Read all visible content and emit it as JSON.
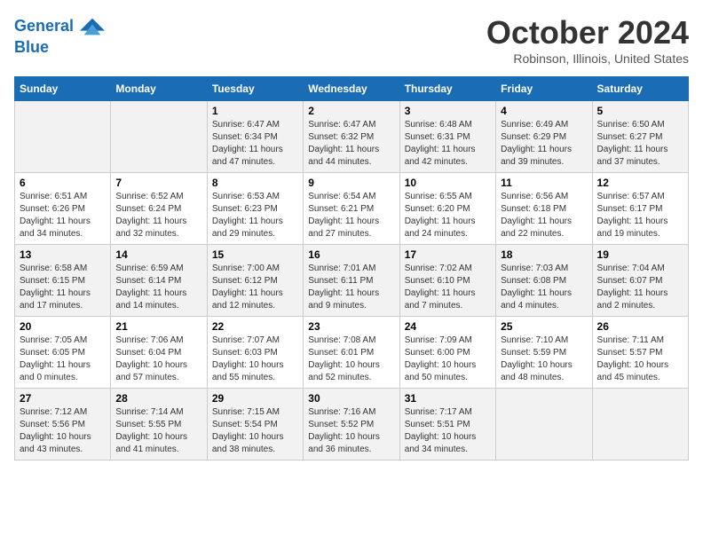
{
  "header": {
    "logo_line1": "General",
    "logo_line2": "Blue",
    "month": "October 2024",
    "location": "Robinson, Illinois, United States"
  },
  "weekdays": [
    "Sunday",
    "Monday",
    "Tuesday",
    "Wednesday",
    "Thursday",
    "Friday",
    "Saturday"
  ],
  "weeks": [
    [
      {
        "day": "",
        "sunrise": "",
        "sunset": "",
        "daylight": ""
      },
      {
        "day": "",
        "sunrise": "",
        "sunset": "",
        "daylight": ""
      },
      {
        "day": "1",
        "sunrise": "Sunrise: 6:47 AM",
        "sunset": "Sunset: 6:34 PM",
        "daylight": "Daylight: 11 hours and 47 minutes."
      },
      {
        "day": "2",
        "sunrise": "Sunrise: 6:47 AM",
        "sunset": "Sunset: 6:32 PM",
        "daylight": "Daylight: 11 hours and 44 minutes."
      },
      {
        "day": "3",
        "sunrise": "Sunrise: 6:48 AM",
        "sunset": "Sunset: 6:31 PM",
        "daylight": "Daylight: 11 hours and 42 minutes."
      },
      {
        "day": "4",
        "sunrise": "Sunrise: 6:49 AM",
        "sunset": "Sunset: 6:29 PM",
        "daylight": "Daylight: 11 hours and 39 minutes."
      },
      {
        "day": "5",
        "sunrise": "Sunrise: 6:50 AM",
        "sunset": "Sunset: 6:27 PM",
        "daylight": "Daylight: 11 hours and 37 minutes."
      }
    ],
    [
      {
        "day": "6",
        "sunrise": "Sunrise: 6:51 AM",
        "sunset": "Sunset: 6:26 PM",
        "daylight": "Daylight: 11 hours and 34 minutes."
      },
      {
        "day": "7",
        "sunrise": "Sunrise: 6:52 AM",
        "sunset": "Sunset: 6:24 PM",
        "daylight": "Daylight: 11 hours and 32 minutes."
      },
      {
        "day": "8",
        "sunrise": "Sunrise: 6:53 AM",
        "sunset": "Sunset: 6:23 PM",
        "daylight": "Daylight: 11 hours and 29 minutes."
      },
      {
        "day": "9",
        "sunrise": "Sunrise: 6:54 AM",
        "sunset": "Sunset: 6:21 PM",
        "daylight": "Daylight: 11 hours and 27 minutes."
      },
      {
        "day": "10",
        "sunrise": "Sunrise: 6:55 AM",
        "sunset": "Sunset: 6:20 PM",
        "daylight": "Daylight: 11 hours and 24 minutes."
      },
      {
        "day": "11",
        "sunrise": "Sunrise: 6:56 AM",
        "sunset": "Sunset: 6:18 PM",
        "daylight": "Daylight: 11 hours and 22 minutes."
      },
      {
        "day": "12",
        "sunrise": "Sunrise: 6:57 AM",
        "sunset": "Sunset: 6:17 PM",
        "daylight": "Daylight: 11 hours and 19 minutes."
      }
    ],
    [
      {
        "day": "13",
        "sunrise": "Sunrise: 6:58 AM",
        "sunset": "Sunset: 6:15 PM",
        "daylight": "Daylight: 11 hours and 17 minutes."
      },
      {
        "day": "14",
        "sunrise": "Sunrise: 6:59 AM",
        "sunset": "Sunset: 6:14 PM",
        "daylight": "Daylight: 11 hours and 14 minutes."
      },
      {
        "day": "15",
        "sunrise": "Sunrise: 7:00 AM",
        "sunset": "Sunset: 6:12 PM",
        "daylight": "Daylight: 11 hours and 12 minutes."
      },
      {
        "day": "16",
        "sunrise": "Sunrise: 7:01 AM",
        "sunset": "Sunset: 6:11 PM",
        "daylight": "Daylight: 11 hours and 9 minutes."
      },
      {
        "day": "17",
        "sunrise": "Sunrise: 7:02 AM",
        "sunset": "Sunset: 6:10 PM",
        "daylight": "Daylight: 11 hours and 7 minutes."
      },
      {
        "day": "18",
        "sunrise": "Sunrise: 7:03 AM",
        "sunset": "Sunset: 6:08 PM",
        "daylight": "Daylight: 11 hours and 4 minutes."
      },
      {
        "day": "19",
        "sunrise": "Sunrise: 7:04 AM",
        "sunset": "Sunset: 6:07 PM",
        "daylight": "Daylight: 11 hours and 2 minutes."
      }
    ],
    [
      {
        "day": "20",
        "sunrise": "Sunrise: 7:05 AM",
        "sunset": "Sunset: 6:05 PM",
        "daylight": "Daylight: 11 hours and 0 minutes."
      },
      {
        "day": "21",
        "sunrise": "Sunrise: 7:06 AM",
        "sunset": "Sunset: 6:04 PM",
        "daylight": "Daylight: 10 hours and 57 minutes."
      },
      {
        "day": "22",
        "sunrise": "Sunrise: 7:07 AM",
        "sunset": "Sunset: 6:03 PM",
        "daylight": "Daylight: 10 hours and 55 minutes."
      },
      {
        "day": "23",
        "sunrise": "Sunrise: 7:08 AM",
        "sunset": "Sunset: 6:01 PM",
        "daylight": "Daylight: 10 hours and 52 minutes."
      },
      {
        "day": "24",
        "sunrise": "Sunrise: 7:09 AM",
        "sunset": "Sunset: 6:00 PM",
        "daylight": "Daylight: 10 hours and 50 minutes."
      },
      {
        "day": "25",
        "sunrise": "Sunrise: 7:10 AM",
        "sunset": "Sunset: 5:59 PM",
        "daylight": "Daylight: 10 hours and 48 minutes."
      },
      {
        "day": "26",
        "sunrise": "Sunrise: 7:11 AM",
        "sunset": "Sunset: 5:57 PM",
        "daylight": "Daylight: 10 hours and 45 minutes."
      }
    ],
    [
      {
        "day": "27",
        "sunrise": "Sunrise: 7:12 AM",
        "sunset": "Sunset: 5:56 PM",
        "daylight": "Daylight: 10 hours and 43 minutes."
      },
      {
        "day": "28",
        "sunrise": "Sunrise: 7:14 AM",
        "sunset": "Sunset: 5:55 PM",
        "daylight": "Daylight: 10 hours and 41 minutes."
      },
      {
        "day": "29",
        "sunrise": "Sunrise: 7:15 AM",
        "sunset": "Sunset: 5:54 PM",
        "daylight": "Daylight: 10 hours and 38 minutes."
      },
      {
        "day": "30",
        "sunrise": "Sunrise: 7:16 AM",
        "sunset": "Sunset: 5:52 PM",
        "daylight": "Daylight: 10 hours and 36 minutes."
      },
      {
        "day": "31",
        "sunrise": "Sunrise: 7:17 AM",
        "sunset": "Sunset: 5:51 PM",
        "daylight": "Daylight: 10 hours and 34 minutes."
      },
      {
        "day": "",
        "sunrise": "",
        "sunset": "",
        "daylight": ""
      },
      {
        "day": "",
        "sunrise": "",
        "sunset": "",
        "daylight": ""
      }
    ]
  ]
}
